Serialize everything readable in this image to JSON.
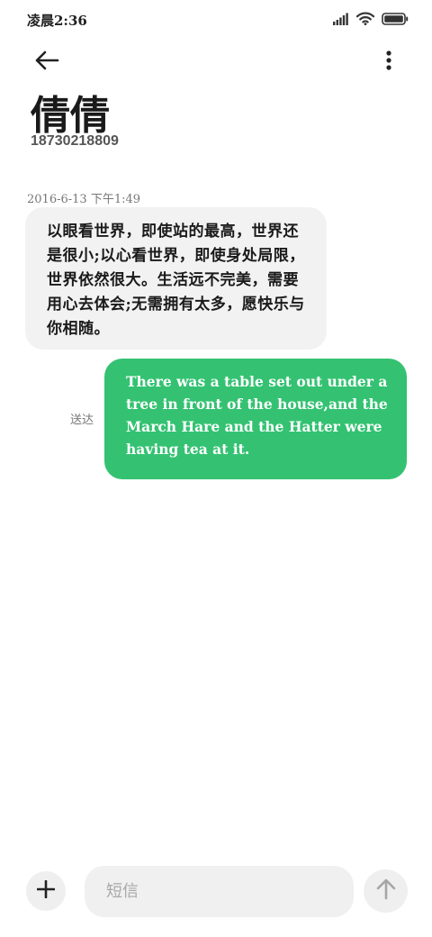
{
  "status_bar": {
    "time": "凌晨2:36",
    "signal_icon": "signal-bars-icon",
    "wifi_icon": "wifi-icon",
    "battery_icon": "battery-icon"
  },
  "top_bar": {
    "back_icon": "back-arrow-icon",
    "more_icon": "more-vertical-icon"
  },
  "contact": {
    "name": "倩倩",
    "number": "18730218809"
  },
  "messages": [
    {
      "direction": "incoming",
      "timestamp": "2016-6-13 下午1:49",
      "text": "以眼看世界，即使站的最高，世界还是很小;以心看世界，即使身处局限，世界依然很大。生活远不完美，需要用心去体会;无需拥有太多，愿快乐与你相随。"
    },
    {
      "direction": "outgoing",
      "status": "送达",
      "text": "There was a table set out under a tree in front of the house,and the March Hare and the Hatter were having tea at it."
    }
  ],
  "composer": {
    "add_icon": "plus-icon",
    "placeholder": "短信",
    "value": "",
    "send_icon": "send-arrow-up-icon"
  },
  "colors": {
    "outgoing_bubble": "#34c272",
    "incoming_bubble": "#f2f2f2",
    "background": "#ffffff"
  }
}
